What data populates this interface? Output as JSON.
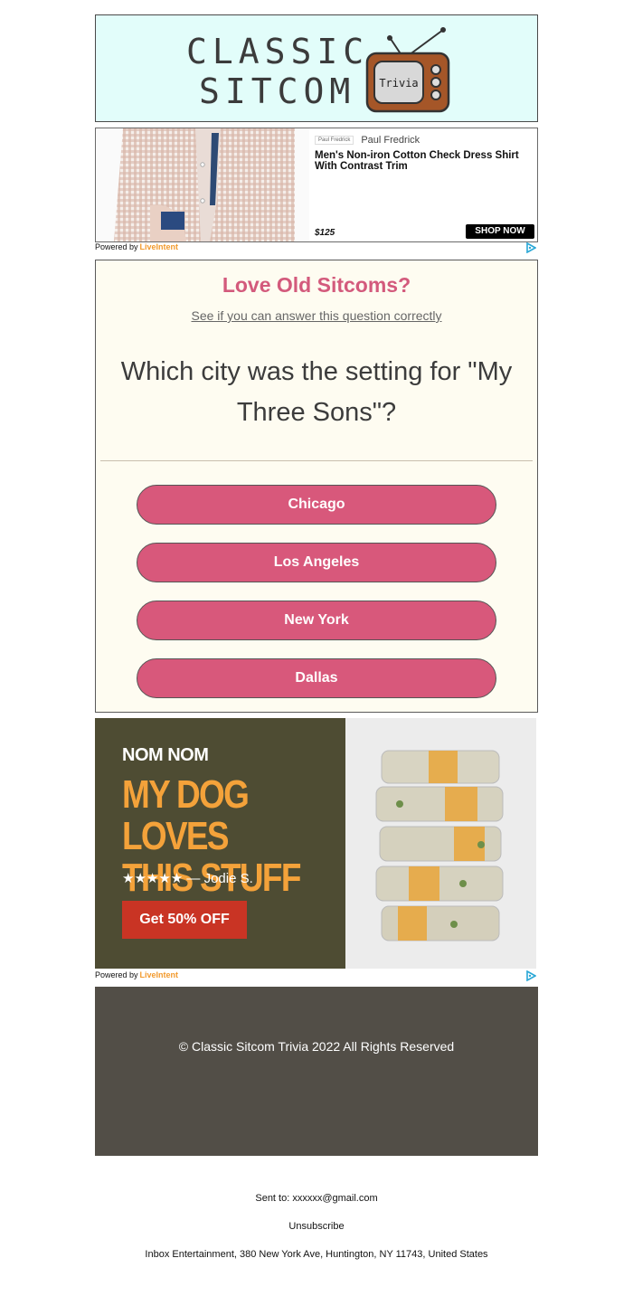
{
  "header": {
    "logo_line1": "CLASSIC",
    "logo_line2": "SITCOM",
    "tv_label": "Trivia"
  },
  "ad_shirt": {
    "brand_chip": "Paul Fredrick",
    "brand": "Paul Fredrick",
    "title": "Men's Non-iron Cotton Check Dress Shirt With Contrast Trim",
    "price": "$125",
    "cta": "SHOP NOW",
    "powered_by": "Powered by",
    "powered_brand": "LiveIntent"
  },
  "trivia": {
    "heading": "Love Old Sitcoms?",
    "subheading": "See if you can answer this question correctly",
    "question": "Which city was the setting for \"My Three Sons\"?",
    "answers": [
      "Chicago",
      "Los Angeles",
      "New York",
      "Dallas"
    ],
    "accent_color": "#d8587b"
  },
  "ad_dogfood": {
    "brand": "NOM NOM",
    "headline": "MY DOG LOVES THIS STUFF",
    "review": "★★★★★ — Jodie S.",
    "cta": "Get 50% OFF",
    "powered_by": "Powered by",
    "powered_brand": "LiveIntent"
  },
  "footer": {
    "copyright": "© Classic Sitcom Trivia 2022 All Rights Reserved",
    "sent_to_label": "Sent to:",
    "sent_to_email": "xxxxxx@gmail.com",
    "unsubscribe": "Unsubscribe",
    "address": "Inbox Entertainment, 380 New York Ave, Huntington, NY 11743, United States"
  }
}
